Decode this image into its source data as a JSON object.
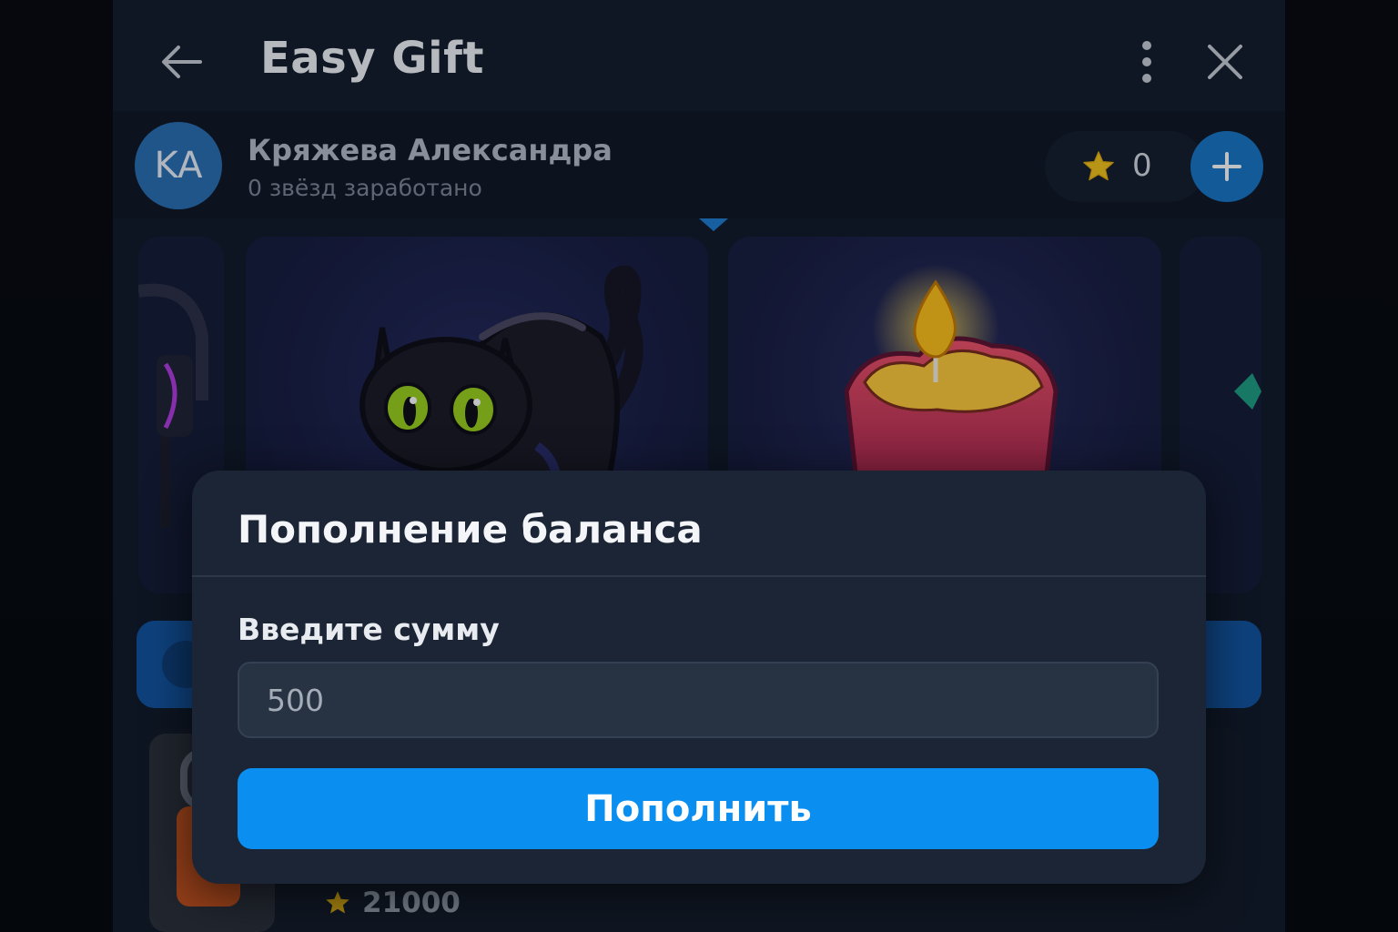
{
  "header": {
    "title": "Easy Gift",
    "icons": {
      "back": "arrow-left-icon",
      "more": "more-vertical-icon",
      "close": "close-icon"
    }
  },
  "profile": {
    "initials": "KA",
    "name": "Кряжева Александра",
    "subtitle": "0 звёзд заработано",
    "balance": "0",
    "colors": {
      "avatar": "#2a6fb3",
      "add_button": "#1976c6",
      "star": "#f5c518"
    }
  },
  "gifts": [
    {
      "name": "black-cat",
      "icon": "black-cat-icon"
    },
    {
      "name": "heart-candle",
      "icon": "heart-candle-icon"
    }
  ],
  "list": {
    "price": "21000"
  },
  "modal": {
    "title": "Пополнение баланса",
    "field_label": "Введите сумму",
    "placeholder": "500",
    "submit_label": "Пополнить",
    "colors": {
      "background": "#1c2535",
      "submit": "#0a8ef0"
    }
  }
}
